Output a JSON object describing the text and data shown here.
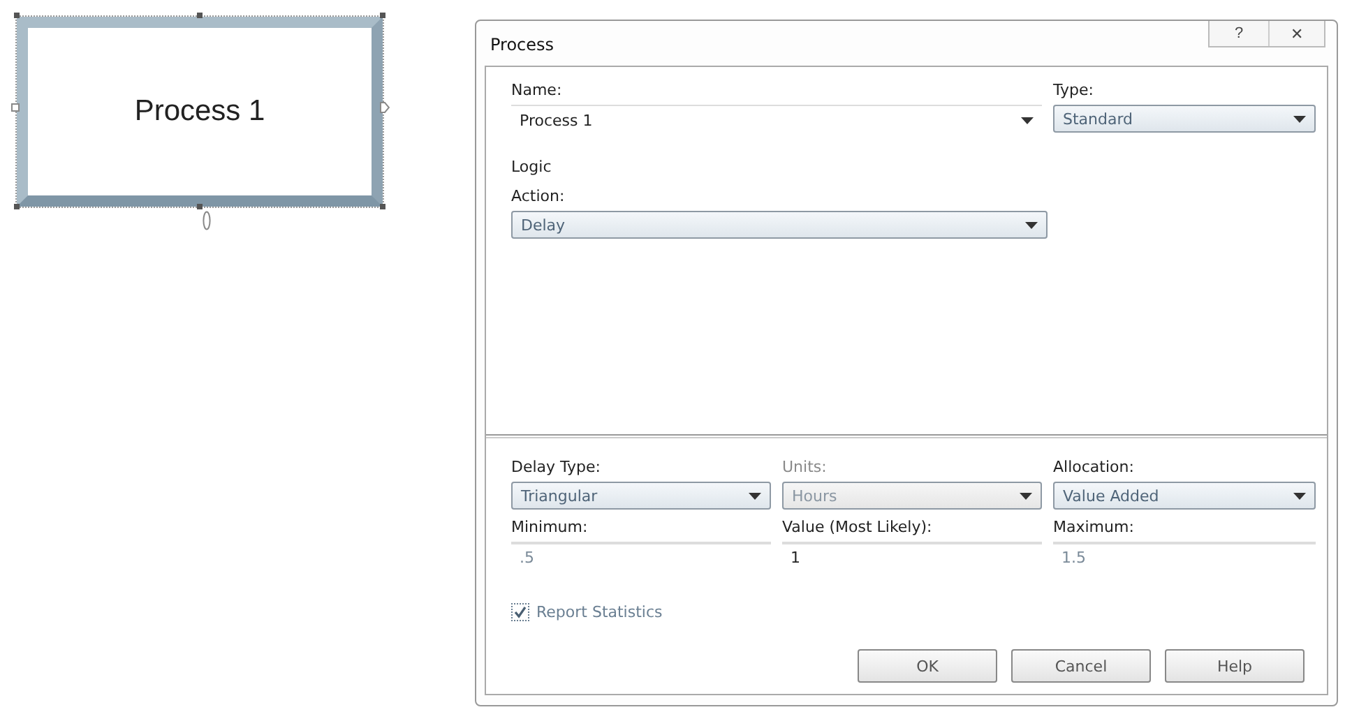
{
  "canvas": {
    "shape": {
      "label": "Process 1",
      "selected": true
    }
  },
  "dialog": {
    "title": "Process",
    "title_buttons": [
      "?",
      "✕"
    ],
    "name": {
      "label": "Name:",
      "value": "Process 1"
    },
    "type": {
      "label": "Type:",
      "value": "Standard"
    },
    "section": "Logic",
    "action": {
      "label": "Action:",
      "value": "Delay"
    },
    "row_dropdowns": [
      {
        "label": "Delay Type:",
        "value": "Triangular",
        "disabled": false
      },
      {
        "label": "Units:",
        "value": "Hours",
        "disabled": true
      },
      {
        "label": "Allocation:",
        "value": "Value Added",
        "disabled": false
      }
    ],
    "row_fields": [
      {
        "label": "Minimum:",
        "value": ".5",
        "disabled": true
      },
      {
        "label": "Value (Most Likely):",
        "value": "1",
        "disabled": false
      },
      {
        "label": "Maximum:",
        "value": "1.5",
        "disabled": true
      }
    ],
    "report_statistics": {
      "label": "Report Statistics",
      "checked": true
    },
    "buttons": [
      "OK",
      "Cancel",
      "Help"
    ]
  }
}
